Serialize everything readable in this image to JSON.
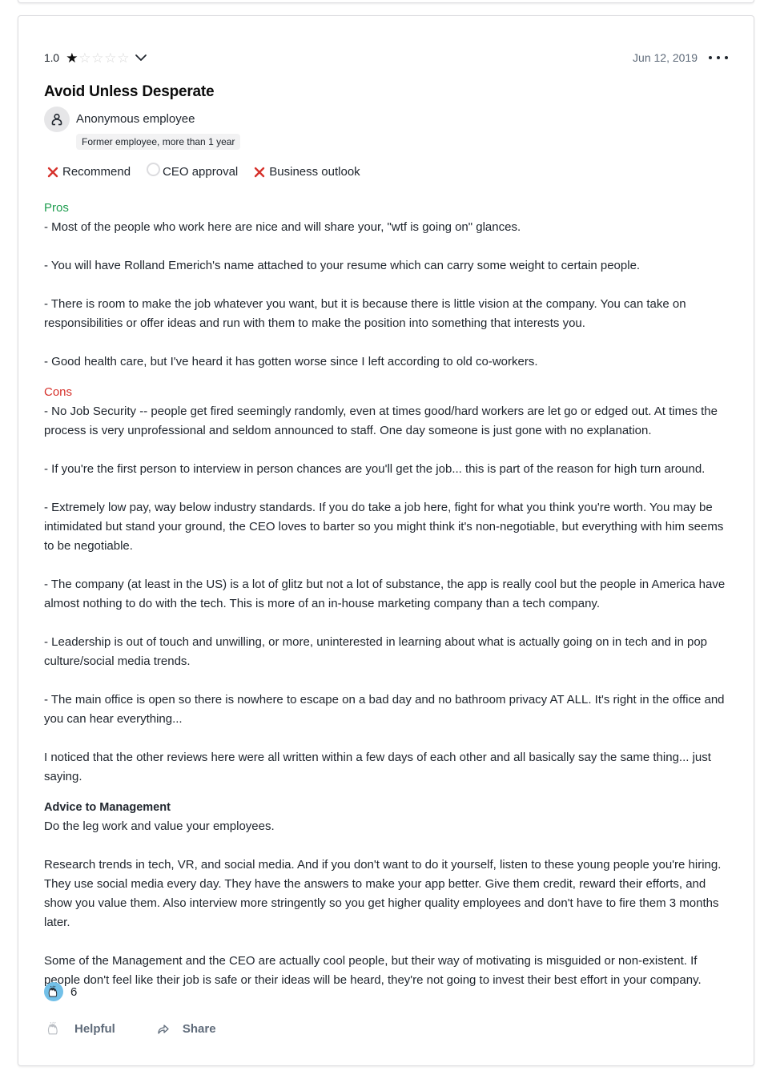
{
  "review": {
    "rating_value": "1.0",
    "rating_stars": 1,
    "rating_max": 5,
    "date": "Jun 12, 2019",
    "title": "Avoid Unless Desperate",
    "author": {
      "name": "Anonymous employee",
      "status": "Former employee, more than 1 year"
    },
    "ratings": [
      {
        "label": "Recommend",
        "state": "negative",
        "icon": "x-icon"
      },
      {
        "label": "CEO approval",
        "state": "neutral",
        "icon": "circle-icon"
      },
      {
        "label": "Business outlook",
        "state": "negative",
        "icon": "x-icon"
      }
    ],
    "pros": {
      "title": "Pros",
      "paragraphs": [
        "- Most of the people who work here are nice and will share your, \"wtf is going on\" glances.",
        "- You will have Rolland Emerich's name attached to your resume which can carry some weight to certain people.",
        "- There is room to make the job whatever you want, but it is because there is little vision at the company. You can take on responsibilities or offer ideas and run with them to make the position into something that interests you.",
        "- Good health care, but I've heard it has gotten worse since I left according to old co-workers."
      ]
    },
    "cons": {
      "title": "Cons",
      "paragraphs": [
        "- No Job Security -- people get fired seemingly randomly, even at times good/hard workers are let go or edged out. At times the process is very unprofessional and seldom announced to staff. One day someone is just gone with no explanation.",
        "- If you're the first person to interview in person chances are you'll get the job... this is part of the reason for high turn around.",
        "- Extremely low pay, way below industry standards. If you do take a job here, fight for what you think you're worth. You may be intimidated but stand your ground, the CEO loves to barter so you might think it's non-negotiable, but everything with him seems to be negotiable.",
        "- The company (at least in the US) is a lot of glitz but not a lot of substance, the app is really cool but the people in America have almost nothing to do with the tech. This is more of an in-house marketing company than a tech company.",
        "- Leadership is out of touch and unwilling, or more, uninterested in learning about what is actually going on in tech and in pop culture/social media trends.",
        "- The main office is open so there is nowhere to escape on a bad day and no bathroom privacy AT ALL. It's right in the office and you can hear everything...",
        "I noticed that the other reviews here were all written within a few days of each other and all basically say the same thing... just saying."
      ]
    },
    "advice": {
      "title": "Advice to Management",
      "paragraphs": [
        "Do the leg work and value your employees.",
        "Research trends in tech, VR, and social media. And if you don't want to do it yourself, listen to these young people you're hiring. They use social media every day. They have the answers to make your app better. Give them credit, reward their efforts, and show you value them. Also interview more stringently so you get higher quality employees and don't have to fire them 3 months later.",
        "Some of the Management and the CEO are actually cool people, but their way of motivating is misguided or non-existent. If people don't feel like their job is safe or their ideas will be heard, they're not going to invest their best effort in your company."
      ]
    },
    "helpful_count": "6",
    "actions": {
      "helpful_label": "Helpful",
      "share_label": "Share"
    }
  },
  "colors": {
    "pros": "#1e9d4f",
    "cons": "#d6312b",
    "negative_icon": "#d6312b",
    "helpful_badge": "#72c0e8",
    "muted_text": "#5f6b7a"
  }
}
